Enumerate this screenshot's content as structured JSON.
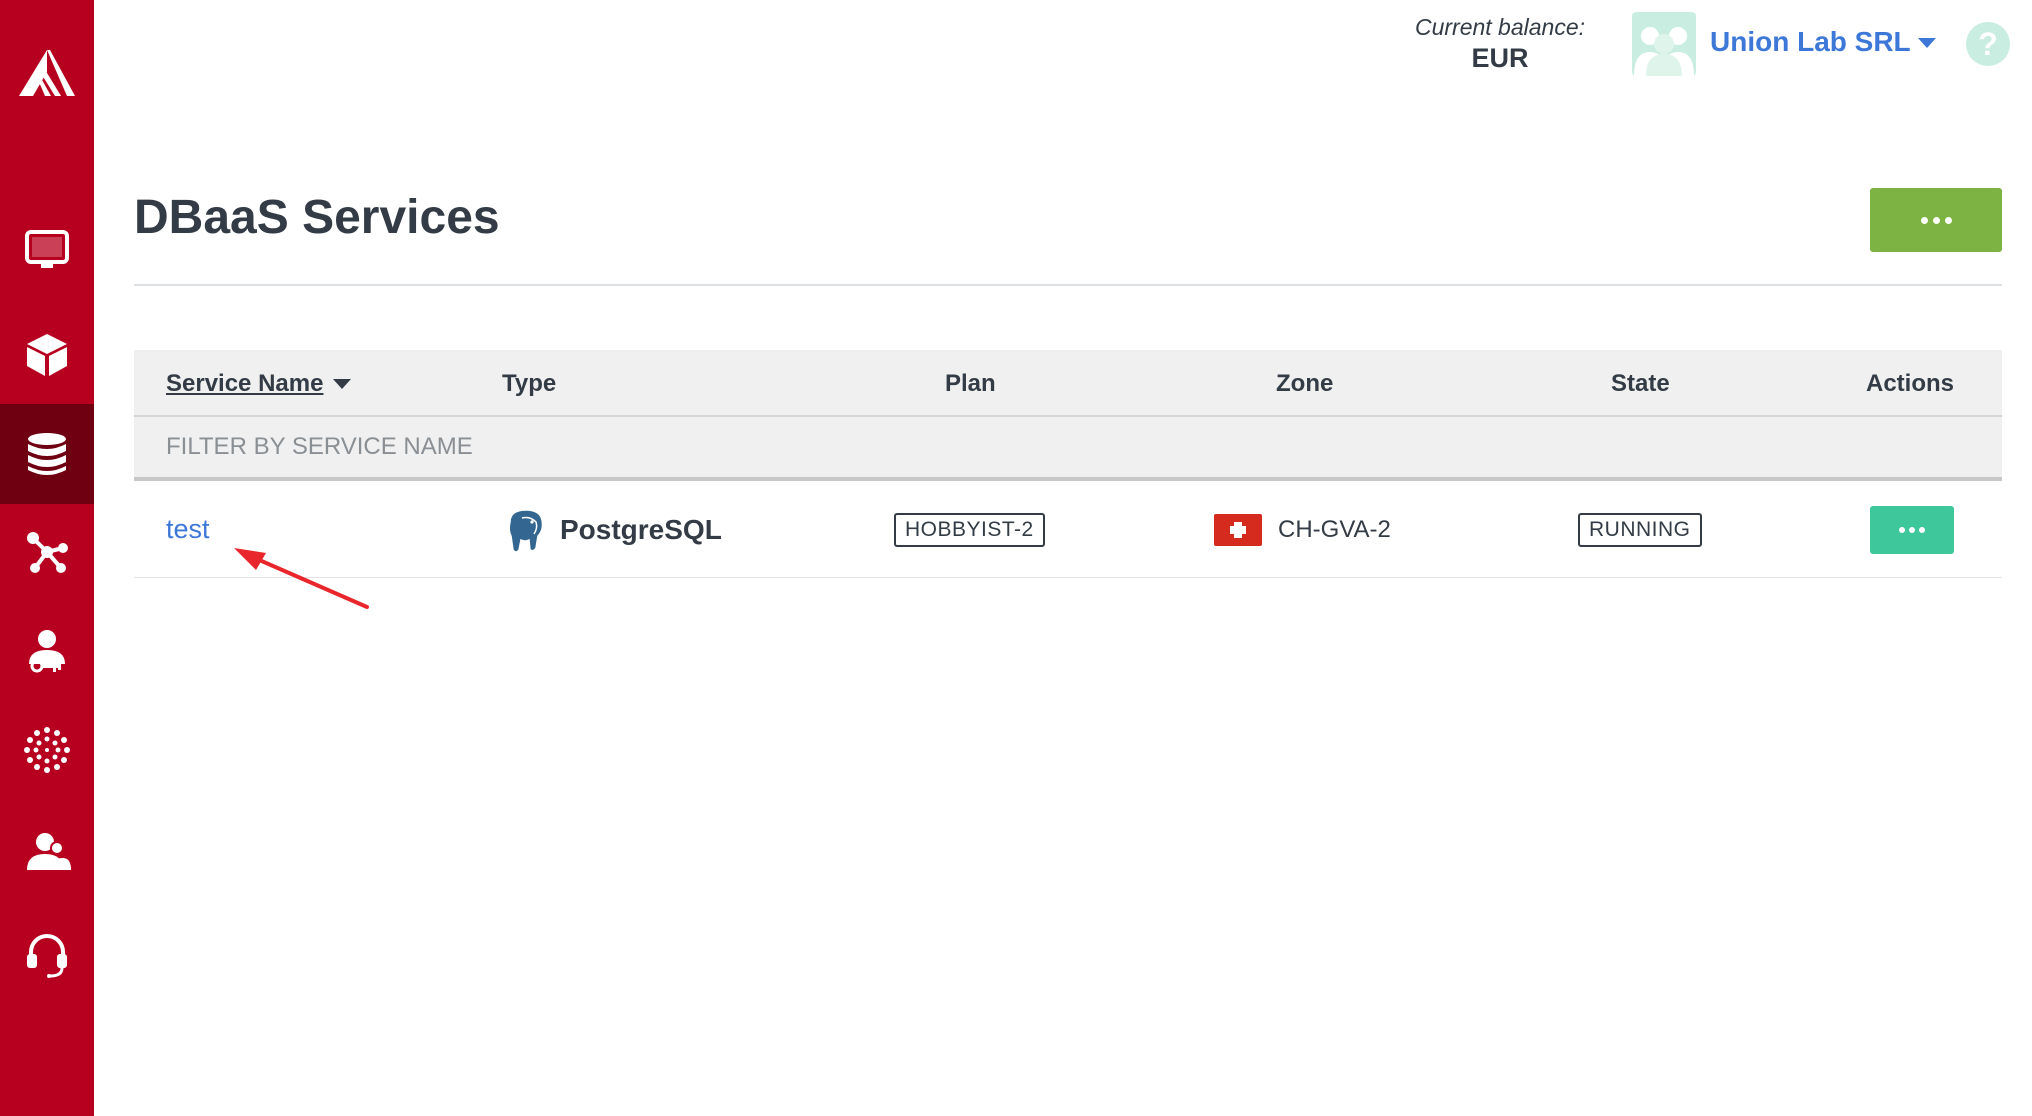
{
  "header": {
    "balance_label": "Current balance:",
    "balance_value": "EUR",
    "org_name": "Union Lab SRL",
    "help_symbol": "?"
  },
  "sidebar": {
    "active_item": "dbaas",
    "items": [
      {
        "id": "compute",
        "icon": "monitor-icon"
      },
      {
        "id": "storage",
        "icon": "cube-icon"
      },
      {
        "id": "dbaas",
        "icon": "database-icon"
      },
      {
        "id": "network",
        "icon": "network-icon"
      },
      {
        "id": "iam",
        "icon": "user-key-icon"
      },
      {
        "id": "apps",
        "icon": "dots-circle-icon"
      },
      {
        "id": "account",
        "icon": "users-icon"
      },
      {
        "id": "support",
        "icon": "headset-icon"
      }
    ]
  },
  "page": {
    "title": "DBaaS Services"
  },
  "table": {
    "columns": {
      "service_name": "Service Name",
      "type": "Type",
      "plan": "Plan",
      "zone": "Zone",
      "state": "State",
      "actions": "Actions"
    },
    "filter_placeholder": "FILTER BY SERVICE NAME",
    "rows": [
      {
        "name": "test",
        "type": "PostgreSQL",
        "type_icon": "postgresql-elephant-icon",
        "plan": "HOBBYIST-2",
        "zone": "CH-GVA-2",
        "zone_flag": "switzerland-flag-icon",
        "state": "RUNNING"
      }
    ]
  },
  "colors": {
    "sidebar": "#b7001f",
    "sidebar_active": "#6f0012",
    "link": "#3d78d8",
    "primary_button": "#7cb342",
    "row_action_button": "#3ec79a",
    "annotation_arrow": "#e8262b"
  }
}
